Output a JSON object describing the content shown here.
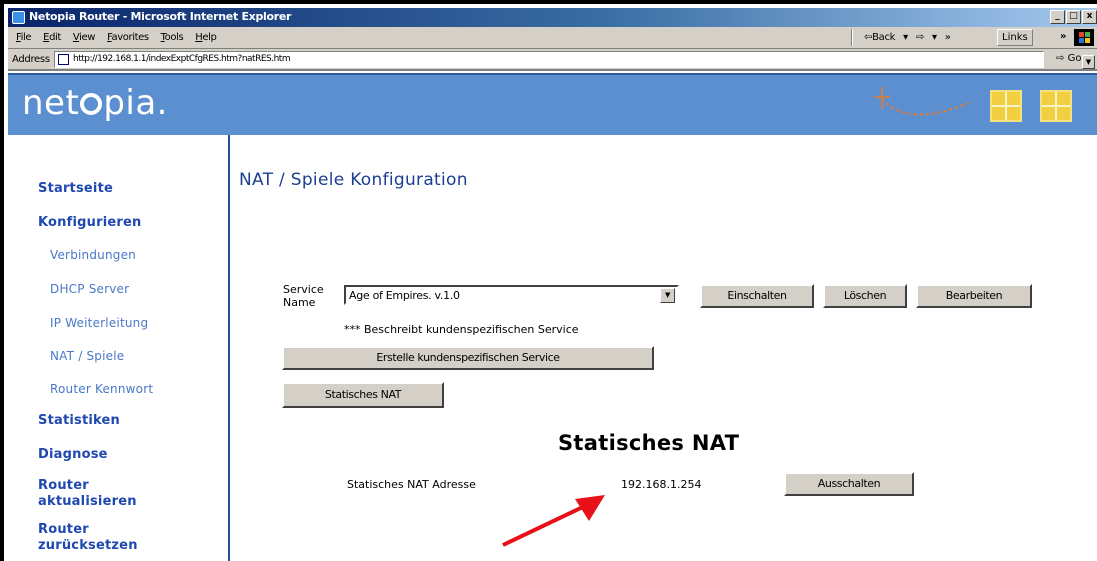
{
  "window": {
    "title": "Netopia Router - Microsoft Internet Explorer",
    "controls": {
      "minimize": "_",
      "maximize": "□",
      "close": "x"
    }
  },
  "menubar": {
    "items": [
      "File",
      "Edit",
      "View",
      "Favorites",
      "Tools",
      "Help"
    ],
    "back": "⇦Back",
    "back_arrow": "▾",
    "forward": "⇨",
    "forward_arrow": "▾",
    "more": "»",
    "links": "Links",
    "links_more": "»"
  },
  "addressbar": {
    "label": "Address",
    "url": "http://192.168.1.1/indexExptCfgRES.htm?natRES.htm",
    "go": "Go"
  },
  "header": {
    "logo_pre": "net",
    "logo_post": "pia."
  },
  "sidebar": {
    "items": [
      {
        "label": "Startseite",
        "type": "top"
      },
      {
        "label": "Konfigurieren",
        "type": "top"
      },
      {
        "label": "Verbindungen",
        "type": "sub"
      },
      {
        "label": "DHCP Server",
        "type": "sub"
      },
      {
        "label": "IP Weiterleitung",
        "type": "sub"
      },
      {
        "label": "NAT / Spiele",
        "type": "sub"
      },
      {
        "label": "Router Kennwort",
        "type": "sub"
      },
      {
        "label": "Statistiken",
        "type": "top"
      },
      {
        "label": "Diagnose",
        "type": "top"
      },
      {
        "label": "Router aktualisieren",
        "type": "top"
      },
      {
        "label": "Router zurücksetzen",
        "type": "top"
      }
    ]
  },
  "main": {
    "page_title": "NAT / Spiele Konfiguration",
    "service_label": "Service Name",
    "service_selected": "Age of Empires. v.1.0",
    "buttons": {
      "enable": "Einschalten",
      "delete": "Löschen",
      "edit": "Bearbeiten",
      "create_custom": "Erstelle kundenspezifischen Service",
      "static_nat": "Statisches NAT",
      "disable": "Ausschalten"
    },
    "custom_note": "*** Beschreibt kundenspezifischen Service",
    "static_section": {
      "title": "Statisches NAT",
      "address_label": "Statisches NAT Adresse",
      "address_value": "192.168.1.254"
    }
  },
  "colors": {
    "header_bg": "#5b8fcf",
    "nav_link": "#1f48b0",
    "nav_sub": "#4a78c8",
    "arrow": "#e8111a"
  },
  "icons": [
    "ie-icon",
    "page-icon",
    "go-icon",
    "windows-flag-icon",
    "window-icon",
    "dotted-arrow-icon",
    "red-arrow-icon",
    "dropdown-arrow-icon"
  ]
}
